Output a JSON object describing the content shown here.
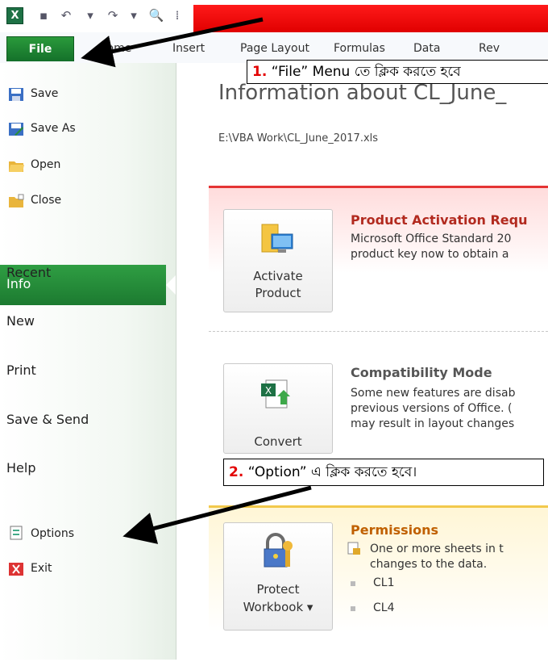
{
  "ribbon": {
    "file": "File",
    "tabs": [
      "Home",
      "Insert",
      "Page Layout",
      "Formulas",
      "Data",
      "Rev"
    ]
  },
  "left": {
    "commands": [
      "Save",
      "Save As",
      "Open",
      "Close"
    ],
    "selected": "Info",
    "nav": [
      "Recent",
      "New",
      "Print",
      "Save & Send",
      "Help"
    ],
    "bottom": [
      "Options",
      "Exit"
    ]
  },
  "main": {
    "title": "Information about CL_June_",
    "path": "E:\\VBA Work\\CL_June_2017.xls",
    "activation": {
      "button": [
        "Activate",
        "Product"
      ],
      "heading": "Product Activation Requ",
      "lines": [
        "Microsoft Office Standard 20",
        "product key now to obtain a"
      ]
    },
    "compat": {
      "button": [
        "Convert"
      ],
      "heading": "Compatibility Mode",
      "lines": [
        "Some new features are disab",
        "previous versions of Office. (",
        "may result in layout changes"
      ]
    },
    "perms": {
      "button": [
        "Protect",
        "Workbook ▾"
      ],
      "heading": "Permissions",
      "lines": [
        "One or more sheets in t",
        "changes to the data."
      ],
      "sheets": [
        "CL1",
        "CL4"
      ]
    }
  },
  "callouts": {
    "one": {
      "num": "1.",
      "text": "“File” Menu তে ক্লিক করতে হবে"
    },
    "two": {
      "num": "2.",
      "text": "“Option” এ ক্লিক করতে হবে।"
    }
  },
  "colors": {
    "file_green": "#1c7a30",
    "title_red": "#e00000",
    "activation_red": "#c0392b",
    "compat_grey": "#555555",
    "perm_orange": "#c06000"
  }
}
